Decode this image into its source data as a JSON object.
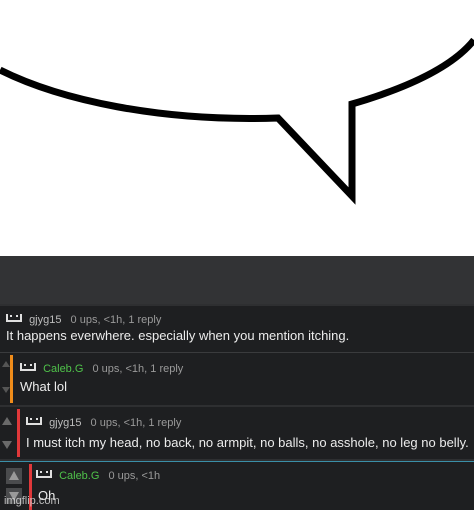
{
  "thread": {
    "comments": [
      {
        "user": "gjyg15",
        "meta": "0 ups, <1h, 1 reply",
        "text": "It happens everwhere. especially when you mention itching."
      },
      {
        "user": "Caleb.G",
        "meta": "0 ups, <1h, 1 reply",
        "text": "What lol",
        "bar_color": "#f08c1a"
      },
      {
        "user": "gjyg15",
        "meta": "0 ups, <1h, 1 reply",
        "text": "I must itch my head, no back, no armpit, no balls, no asshole, no leg no belly.",
        "bar_color": "#e0383a"
      },
      {
        "user": "Caleb.G",
        "meta": "0 ups, <1h",
        "text": "Oh",
        "bar_color": "#e0383a"
      }
    ]
  },
  "watermark": "imgflip.com",
  "icons": {
    "upvote": "arrow-up-icon",
    "downvote": "arrow-down-icon",
    "avatar": "pixel-face-icon"
  }
}
